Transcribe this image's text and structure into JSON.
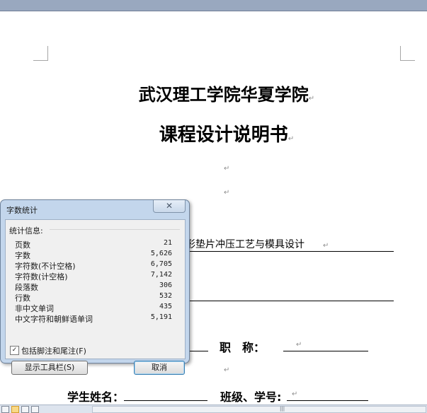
{
  "document": {
    "title_line1": "武汉理工学院华夏学院",
    "title_line2": "课程设计说明书",
    "paragraph_mark": "↵",
    "topic_fragment": "形垫片冲压工艺与模具设计",
    "field_title": "职　称：",
    "field_student_name": "学生姓名：",
    "field_class_id": "班级、学号:"
  },
  "dialog": {
    "title": "字数统计",
    "close_glyph": "✕",
    "group_label": "统计信息:",
    "stats": [
      {
        "label": "页数",
        "value": "21"
      },
      {
        "label": "字数",
        "value": "5,626"
      },
      {
        "label": "字符数(不计空格)",
        "value": "6,705"
      },
      {
        "label": "字符数(计空格)",
        "value": "7,142"
      },
      {
        "label": "段落数",
        "value": "306"
      },
      {
        "label": "行数",
        "value": "532"
      },
      {
        "label": "非中文单词",
        "value": "435"
      },
      {
        "label": "中文字符和朝鲜语单词",
        "value": "5,191"
      }
    ],
    "checkbox_label": "包括脚注和尾注(F)",
    "checkbox_checked": true,
    "show_toolbar_button": "显示工具栏(S)",
    "cancel_button": "取消"
  },
  "colors": {
    "dialog_frame": "#c3d6ec",
    "title_strip": "#99a8bf",
    "cancel_focus": "#3c7fb1"
  }
}
